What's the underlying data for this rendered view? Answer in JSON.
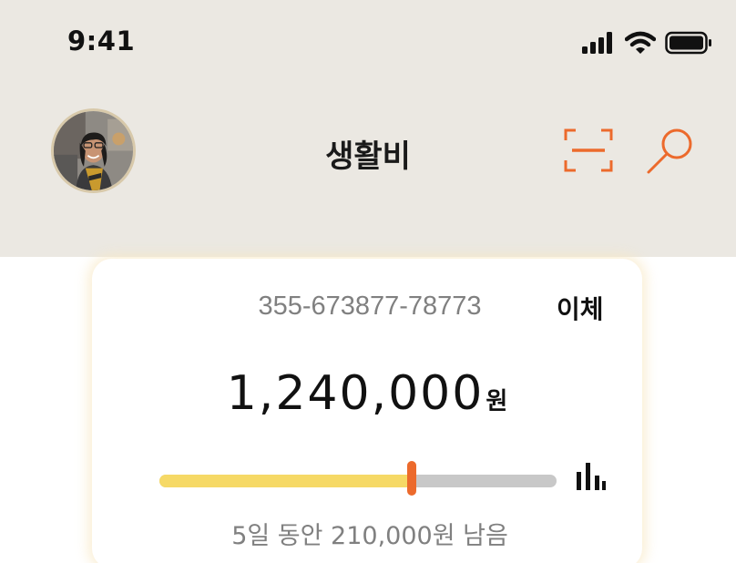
{
  "status_bar": {
    "time": "9:41",
    "icons": [
      "cellular-signal-icon",
      "wifi-icon",
      "battery-icon"
    ]
  },
  "header": {
    "avatar": "profile-photo",
    "title": "생활비",
    "scan_icon": "scan-icon",
    "search_icon": "search-icon"
  },
  "account_card": {
    "account_number": "355-673877-78773",
    "transfer_label": "이체",
    "balance": "1,240,000",
    "balance_unit": "원",
    "budget_used_fraction": 0.635,
    "stats_icon": "bar-chart-icon",
    "remaining_text": "5일 동안 210,000원 남음"
  },
  "colors": {
    "header_background": "#ebe8e2",
    "accent": "#ec6a2c",
    "progress_fill": "#f6d966",
    "progress_track": "#c8c8c8",
    "secondary_text": "#808080"
  }
}
